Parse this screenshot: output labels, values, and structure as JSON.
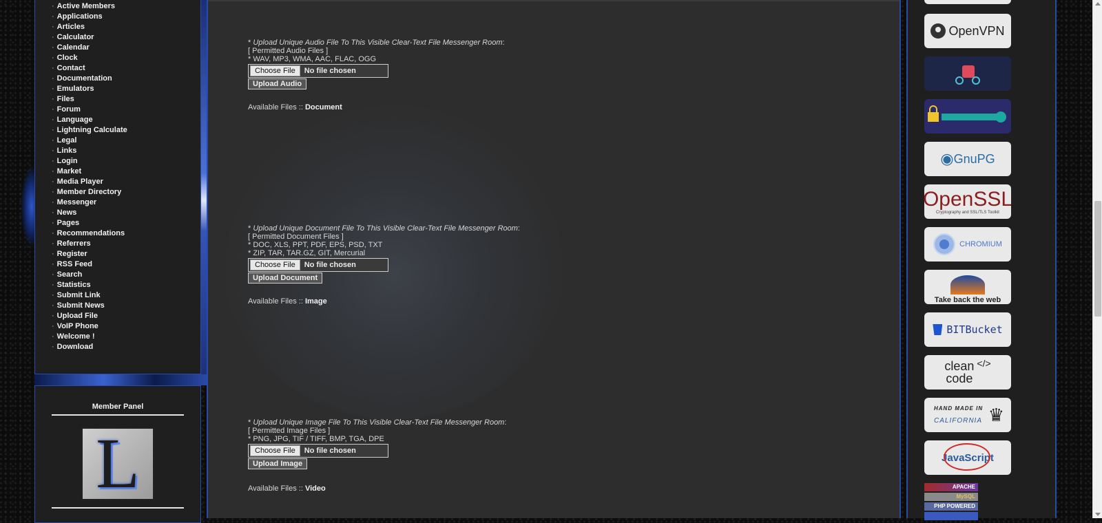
{
  "sidebar": {
    "bullet": "·",
    "items": [
      {
        "label": "Active Members"
      },
      {
        "label": "Applications"
      },
      {
        "label": "Articles"
      },
      {
        "label": "Calculator"
      },
      {
        "label": "Calendar"
      },
      {
        "label": "Clock"
      },
      {
        "label": "Contact"
      },
      {
        "label": "Documentation"
      },
      {
        "label": "Emulators"
      },
      {
        "label": "Files"
      },
      {
        "label": "Forum"
      },
      {
        "label": "Language"
      },
      {
        "label": "Lightning Calculate"
      },
      {
        "label": "Legal"
      },
      {
        "label": "Links"
      },
      {
        "label": "Login"
      },
      {
        "label": "Market"
      },
      {
        "label": "Media Player"
      },
      {
        "label": "Member Directory"
      },
      {
        "label": "Messenger"
      },
      {
        "label": "News"
      },
      {
        "label": "Pages"
      },
      {
        "label": "Recommendations"
      },
      {
        "label": "Referrers"
      },
      {
        "label": "Register"
      },
      {
        "label": "RSS Feed"
      },
      {
        "label": "Search"
      },
      {
        "label": "Statistics"
      },
      {
        "label": "Submit Link"
      },
      {
        "label": "Submit News"
      },
      {
        "label": "Upload File"
      },
      {
        "label": "VoIP Phone"
      },
      {
        "label": "Welcome !"
      },
      {
        "label": "Download"
      }
    ]
  },
  "member_panel": {
    "title": "Member Panel",
    "avatar_letter": "L"
  },
  "uploads": {
    "audio": {
      "heading": "Upload Unique Audio File To This Visible Clear-Text File Messenger Room",
      "prefix": "* ",
      "suffix": ":",
      "permitted": "[ Permitted Audio Files ]",
      "types": [
        "* WAV, MP3, WMA, AAC, FLAC, OGG"
      ],
      "choose_label": "Choose File",
      "no_file": "No file chosen",
      "upload_label": "Upload Audio"
    },
    "document": {
      "heading": "Upload Unique Document File To This Visible Clear-Text File Messenger Room",
      "prefix": "* ",
      "suffix": ":",
      "permitted": "[ Permitted Document Files ]",
      "types": [
        "* DOC, XLS, PPT, PDF, EPS, PSD, TXT",
        "* ZIP, TAR, TAR.GZ, GIT, Mercurial"
      ],
      "choose_label": "Choose File",
      "no_file": "No file chosen",
      "upload_label": "Upload Document"
    },
    "image": {
      "heading": "Upload Unique Image File To This Visible Clear-Text File Messenger Room",
      "prefix": "* ",
      "suffix": ":",
      "permitted": "[ Permitted Image Files ]",
      "types": [
        "* PNG, JPG, TIF / TIFF, BMP, TGA, DPE"
      ],
      "choose_label": "Choose File",
      "no_file": "No file chosen",
      "upload_label": "Upload Image"
    }
  },
  "available": {
    "prefix": "Available Files :: ",
    "document": "Document",
    "image": "Image",
    "video": "Video"
  },
  "right_badges": {
    "openvpn": "OpenVPN",
    "gnupg": "GnuPG",
    "openssl": "OpenSSL",
    "openssl_sub": "Cryptography and SSL/TLS Toolkit",
    "chromium": "CHROMIUM",
    "firefox": "Take back the web",
    "bitbucket": "BITBucket",
    "cleancode_1": "clean",
    "cleancode_2": "code",
    "cleancode_tag": "</>",
    "handmade_1": "HAND MADE IN",
    "handmade_2": "CALIFORNIA",
    "javascript": "JavaScript",
    "apache": "APACHE",
    "mysql": "MySQL",
    "php": "PHP POWERED"
  },
  "colors": {
    "accent_blue": "#2a4aa8",
    "page_bg": "#0c0c0c",
    "main_bg": "#2d2d2d",
    "panel_bg": "#1f1f1f"
  }
}
